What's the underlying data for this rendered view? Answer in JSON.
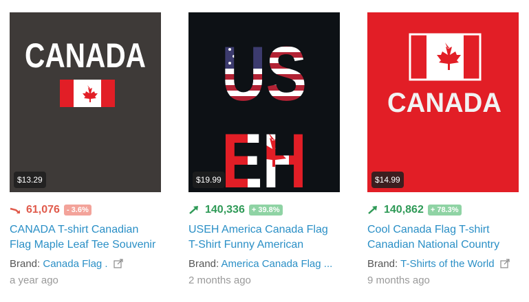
{
  "products": [
    {
      "price": "$13.29",
      "rank": "61,076",
      "change": "- 3.6%",
      "trend": "down",
      "title": "CANADA T-shirt Canadian Flag Maple Leaf Tee Souvenir",
      "brand_label": "Brand:",
      "brand": "Canada Flag .",
      "age": "a year ago",
      "art_text": "CANADA",
      "colors": {
        "bg": "#3e3a38"
      }
    },
    {
      "price": "$19.99",
      "rank": "140,336",
      "change": "+ 39.8%",
      "trend": "up",
      "title": "USEH America Canada Flag T-Shirt Funny American",
      "brand_label": "Brand:",
      "brand": "America Canada Flag ...",
      "age": "2 months ago",
      "art_text": [
        "US",
        "EH"
      ],
      "colors": {
        "bg": "#0d1115"
      }
    },
    {
      "price": "$14.99",
      "rank": "140,862",
      "change": "+ 78.3%",
      "trend": "up",
      "title": "Cool Canada Flag T-shirt Canadian National Country",
      "brand_label": "Brand:",
      "brand": "T-Shirts of the World",
      "age": "9 months ago",
      "art_text": "CANADA",
      "colors": {
        "bg": "#e21e26"
      }
    }
  ],
  "icons": {
    "trend_down": "trend-down-arrow-icon",
    "trend_up": "trend-up-arrow-icon",
    "external": "external-link-icon"
  },
  "colors": {
    "red": "#e21e26",
    "link": "#2a8fc6",
    "up": "#2f9a57",
    "down": "#e05a4b"
  }
}
